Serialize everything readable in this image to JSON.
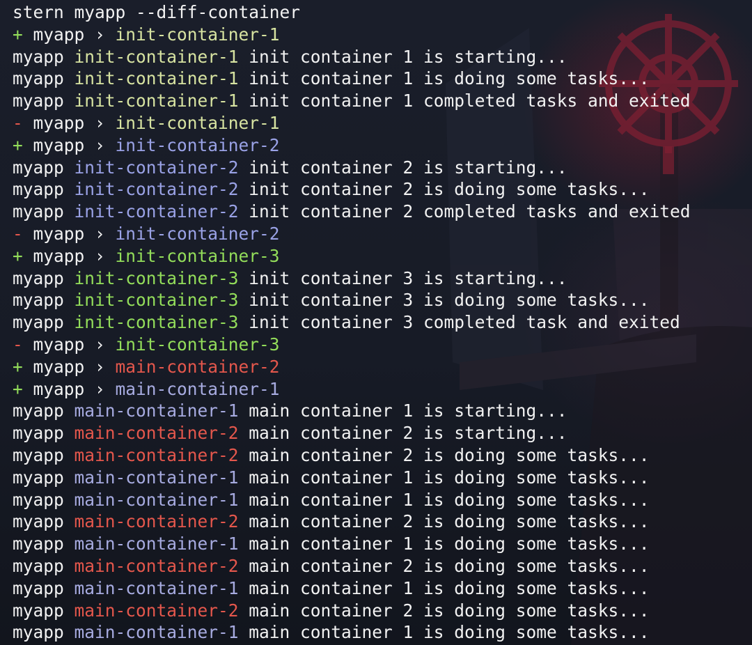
{
  "colors": {
    "background": "#171b26",
    "text": "#f2f2f2",
    "accent_red": "#7d1f32",
    "init-container-1": "#d7e3a1",
    "init-container-2": "#9aa2e6",
    "init-container-3": "#93dd5a",
    "main-container-1": "#a7abe0",
    "main-container-2": "#e4574c",
    "added_marker": "#93dd5a",
    "removed_marker": "#e4574c"
  },
  "terminal": {
    "lines": [
      {
        "segs": [
          {
            "t": "stern myapp --diff-container"
          }
        ]
      },
      {
        "segs": [
          {
            "t": "+ ",
            "c": "added_marker"
          },
          {
            "t": "myapp › "
          },
          {
            "t": "init-container-1",
            "c": "init-container-1"
          }
        ]
      },
      {
        "segs": [
          {
            "t": "myapp "
          },
          {
            "t": "init-container-1",
            "c": "init-container-1"
          },
          {
            "t": " init container 1 is starting..."
          }
        ]
      },
      {
        "segs": [
          {
            "t": "myapp "
          },
          {
            "t": "init-container-1",
            "c": "init-container-1"
          },
          {
            "t": " init container 1 is doing some tasks..."
          }
        ]
      },
      {
        "segs": [
          {
            "t": "myapp "
          },
          {
            "t": "init-container-1",
            "c": "init-container-1"
          },
          {
            "t": " init container 1 completed tasks and exited"
          }
        ]
      },
      {
        "segs": [
          {
            "t": "- ",
            "c": "removed_marker"
          },
          {
            "t": "myapp › "
          },
          {
            "t": "init-container-1",
            "c": "init-container-1"
          }
        ]
      },
      {
        "segs": [
          {
            "t": "+ ",
            "c": "added_marker"
          },
          {
            "t": "myapp › "
          },
          {
            "t": "init-container-2",
            "c": "init-container-2"
          }
        ]
      },
      {
        "segs": [
          {
            "t": "myapp "
          },
          {
            "t": "init-container-2",
            "c": "init-container-2"
          },
          {
            "t": " init container 2 is starting..."
          }
        ]
      },
      {
        "segs": [
          {
            "t": "myapp "
          },
          {
            "t": "init-container-2",
            "c": "init-container-2"
          },
          {
            "t": " init container 2 is doing some tasks..."
          }
        ]
      },
      {
        "segs": [
          {
            "t": "myapp "
          },
          {
            "t": "init-container-2",
            "c": "init-container-2"
          },
          {
            "t": " init container 2 completed tasks and exited"
          }
        ]
      },
      {
        "segs": [
          {
            "t": "- ",
            "c": "removed_marker"
          },
          {
            "t": "myapp › "
          },
          {
            "t": "init-container-2",
            "c": "init-container-2"
          }
        ]
      },
      {
        "segs": [
          {
            "t": "+ ",
            "c": "added_marker"
          },
          {
            "t": "myapp › "
          },
          {
            "t": "init-container-3",
            "c": "init-container-3"
          }
        ]
      },
      {
        "segs": [
          {
            "t": "myapp "
          },
          {
            "t": "init-container-3",
            "c": "init-container-3"
          },
          {
            "t": " init container 3 is starting..."
          }
        ]
      },
      {
        "segs": [
          {
            "t": "myapp "
          },
          {
            "t": "init-container-3",
            "c": "init-container-3"
          },
          {
            "t": " init container 3 is doing some tasks..."
          }
        ]
      },
      {
        "segs": [
          {
            "t": "myapp "
          },
          {
            "t": "init-container-3",
            "c": "init-container-3"
          },
          {
            "t": " init container 3 completed task and exited"
          }
        ]
      },
      {
        "segs": [
          {
            "t": "- ",
            "c": "removed_marker"
          },
          {
            "t": "myapp › "
          },
          {
            "t": "init-container-3",
            "c": "init-container-3"
          }
        ]
      },
      {
        "segs": [
          {
            "t": "+ ",
            "c": "added_marker"
          },
          {
            "t": "myapp › "
          },
          {
            "t": "main-container-2",
            "c": "main-container-2"
          }
        ]
      },
      {
        "segs": [
          {
            "t": "+ ",
            "c": "added_marker"
          },
          {
            "t": "myapp › "
          },
          {
            "t": "main-container-1",
            "c": "main-container-1"
          }
        ]
      },
      {
        "segs": [
          {
            "t": "myapp "
          },
          {
            "t": "main-container-1",
            "c": "main-container-1"
          },
          {
            "t": " main container 1 is starting..."
          }
        ]
      },
      {
        "segs": [
          {
            "t": "myapp "
          },
          {
            "t": "main-container-2",
            "c": "main-container-2"
          },
          {
            "t": " main container 2 is starting..."
          }
        ]
      },
      {
        "segs": [
          {
            "t": "myapp "
          },
          {
            "t": "main-container-2",
            "c": "main-container-2"
          },
          {
            "t": " main container 2 is doing some tasks..."
          }
        ]
      },
      {
        "segs": [
          {
            "t": "myapp "
          },
          {
            "t": "main-container-1",
            "c": "main-container-1"
          },
          {
            "t": " main container 1 is doing some tasks..."
          }
        ]
      },
      {
        "segs": [
          {
            "t": "myapp "
          },
          {
            "t": "main-container-1",
            "c": "main-container-1"
          },
          {
            "t": " main container 1 is doing some tasks..."
          }
        ]
      },
      {
        "segs": [
          {
            "t": "myapp "
          },
          {
            "t": "main-container-2",
            "c": "main-container-2"
          },
          {
            "t": " main container 2 is doing some tasks..."
          }
        ]
      },
      {
        "segs": [
          {
            "t": "myapp "
          },
          {
            "t": "main-container-1",
            "c": "main-container-1"
          },
          {
            "t": " main container 1 is doing some tasks..."
          }
        ]
      },
      {
        "segs": [
          {
            "t": "myapp "
          },
          {
            "t": "main-container-2",
            "c": "main-container-2"
          },
          {
            "t": " main container 2 is doing some tasks..."
          }
        ]
      },
      {
        "segs": [
          {
            "t": "myapp "
          },
          {
            "t": "main-container-1",
            "c": "main-container-1"
          },
          {
            "t": " main container 1 is doing some tasks..."
          }
        ]
      },
      {
        "segs": [
          {
            "t": "myapp "
          },
          {
            "t": "main-container-2",
            "c": "main-container-2"
          },
          {
            "t": " main container 2 is doing some tasks..."
          }
        ]
      },
      {
        "segs": [
          {
            "t": "myapp "
          },
          {
            "t": "main-container-1",
            "c": "main-container-1"
          },
          {
            "t": " main container 1 is doing some tasks..."
          }
        ]
      }
    ]
  }
}
